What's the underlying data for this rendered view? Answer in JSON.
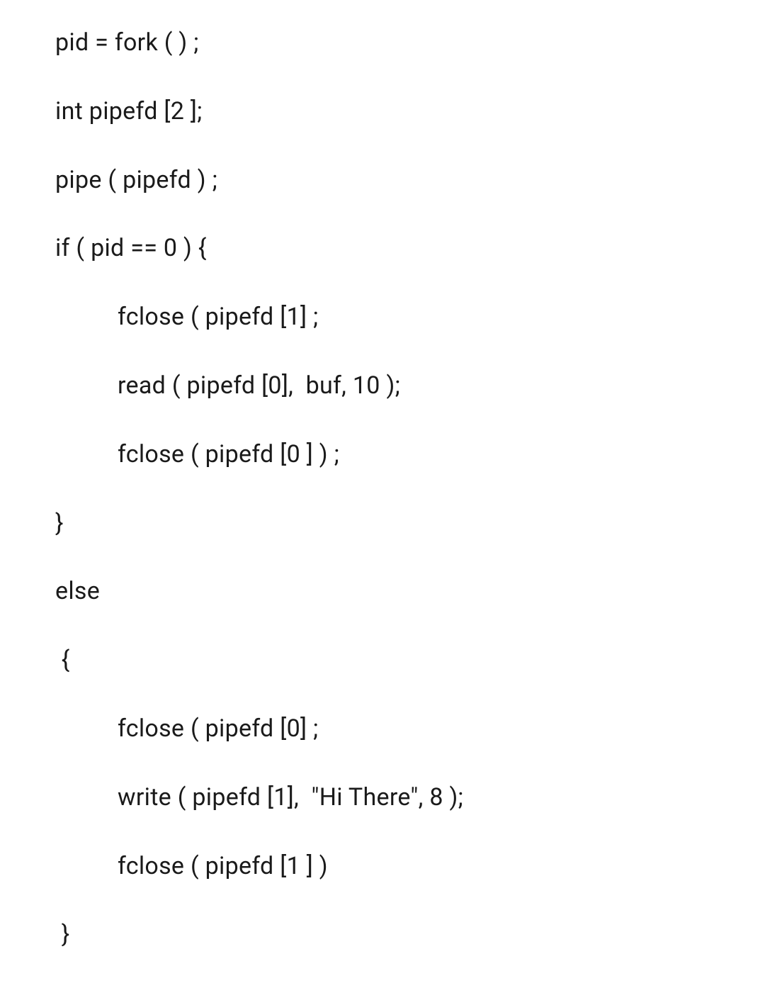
{
  "code": {
    "line1": "pid = fork ( ) ;",
    "line2": "int pipefd [2 ];",
    "line3": "pipe ( pipefd ) ;",
    "line4": "if ( pid == 0 ) {",
    "line5": "fclose ( pipefd [1] ;",
    "line6": "read ( pipefd [0],  buf, 10 );",
    "line7": "fclose ( pipefd [0 ] ) ;",
    "line8": "}",
    "line9": "else",
    "line10": " {",
    "line11": "fclose ( pipefd [0] ;",
    "line12": "write ( pipefd [1],  \"Hi There\", 8 );",
    "line13": "fclose ( pipefd [1 ] )",
    "line14": " }"
  }
}
